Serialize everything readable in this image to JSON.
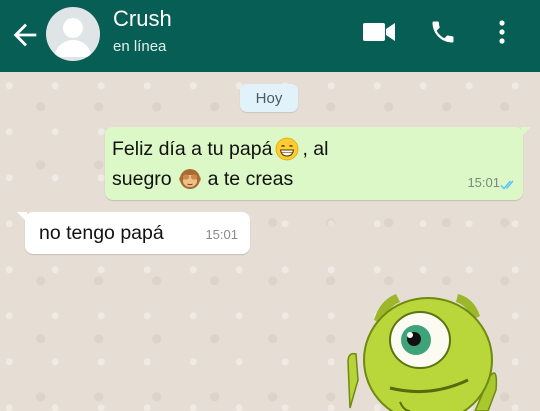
{
  "header": {
    "contact_name": "Crush",
    "status": "en línea",
    "icons": [
      "back-arrow-icon",
      "avatar",
      "video-call-icon",
      "phone-icon",
      "more-options-icon"
    ]
  },
  "chat": {
    "date_separator": "Hoy",
    "messages": [
      {
        "direction": "outgoing",
        "line1_a": "Feliz día a tu papá",
        "line1_emoji": "grinning-face-emoji",
        "line1_b": ", al",
        "line2_a": "suegro",
        "line2_emoji": "see-no-evil-monkey-emoji",
        "line2_b": "a te creas",
        "time": "15:01",
        "status": "read"
      },
      {
        "direction": "incoming",
        "text": "no tengo papá",
        "time": "15:01"
      }
    ],
    "sticker": "mike-wazowski-sticker"
  },
  "colors": {
    "header": "#075e54",
    "outgoing_bubble": "#dcf8c6",
    "incoming_bubble": "#ffffff",
    "read_ticks": "#4fc3f7",
    "chat_background": "#e5ddd5"
  }
}
